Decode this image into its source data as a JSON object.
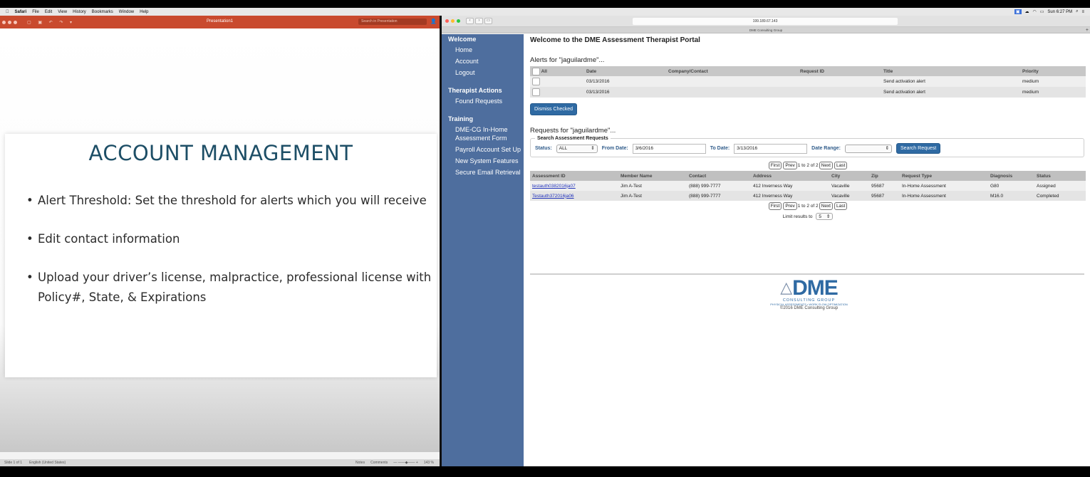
{
  "menubar": {
    "apple": "",
    "app": "Safari",
    "items": [
      "File",
      "Edit",
      "View",
      "History",
      "Bookmarks",
      "Window",
      "Help"
    ],
    "clock": "Sun 6:27 PM"
  },
  "ppt": {
    "window_title": "Presentation1",
    "search_placeholder": "Search in Presentation",
    "slide_title": "ACCOUNT MANAGEMENT",
    "bullets": [
      "Alert Threshold: Set the threshold for alerts which you will receive",
      "Edit contact information",
      "Upload your driver’s license, malpractice, professional license with Policy#, State, & Expirations"
    ],
    "status_slide": "Slide 1 of 1",
    "status_lang": "English (United States)",
    "status_notes": "Notes",
    "status_comments": "Comments",
    "zoom": "143 %"
  },
  "safari": {
    "url": "199.189.67.143",
    "tab_title": "DME Consulting Group"
  },
  "nav": {
    "welcome": "Welcome",
    "home": "Home",
    "account": "Account",
    "logout": "Logout",
    "therapist_actions": "Therapist Actions",
    "found_requests": "Found Requests",
    "training": "Training",
    "assessment_form": "DME-CG In-Home Assessment Form",
    "payroll": "Payroll Account Set Up",
    "new_features": "New System Features",
    "secure_email": "Secure Email Retrieval"
  },
  "portal": {
    "heading": "Welcome to the DME Assessment Therapist Portal",
    "alerts_title": "Alerts for \"jaguilardme\"...",
    "alerts_headers": [
      "All",
      "Date",
      "Company/Contact",
      "Request ID",
      "Title",
      "Priority"
    ],
    "alerts": [
      {
        "date": "03/13/2016",
        "company": "",
        "request_id": "",
        "title": "Send activation alert",
        "priority": "medium"
      },
      {
        "date": "03/13/2016",
        "company": "",
        "request_id": "",
        "title": "Send activation alert",
        "priority": "medium"
      }
    ],
    "dismiss_label": "Dismiss Checked",
    "requests_title": "Requests for \"jaguilardme\"...",
    "search_legend": "Search Assessment Requests",
    "status_label": "Status:",
    "status_value": "ALL",
    "from_label": "From Date:",
    "from_value": "3/6/2016",
    "to_label": "To Date:",
    "to_value": "3/13/2016",
    "range_label": "Date Range:",
    "range_value": "",
    "search_btn": "Search Request",
    "pager": {
      "first": "First",
      "prev": "Prev",
      "info": "1 to 2 of 2",
      "next": "Next",
      "last": "Last"
    },
    "req_headers": [
      "Assessment ID",
      "Member Name",
      "Contact",
      "Address",
      "City",
      "Zip",
      "Request Type",
      "Diagnosis",
      "Status"
    ],
    "requests": [
      {
        "id": "testauth0382016ja07",
        "member": "Jim A-Test",
        "contact": "(888) 999-7777",
        "address": "412 Inverness Way",
        "city": "Vacaville",
        "zip": "95687",
        "type": "In-Home Assessment",
        "diagnosis": "G80",
        "status": "Assigned"
      },
      {
        "id": "Testauth372016ja06",
        "member": "Jim A-Test",
        "contact": "(888) 999-7777",
        "address": "412 Inverness Way",
        "city": "Vacaville",
        "zip": "95687",
        "type": "In-Home Assessment",
        "diagnosis": "M16.0",
        "status": "Completed"
      }
    ],
    "limit_label": "Limit results to",
    "limit_value": "5",
    "logo_text": "DME",
    "logo_sub": "CONSULTING GROUP",
    "logo_tag": "PHYSICAL ASSESSMENTS • WORK FLOW OPTIMIZATION",
    "copyright": "©2016 DME Consulting Group"
  }
}
